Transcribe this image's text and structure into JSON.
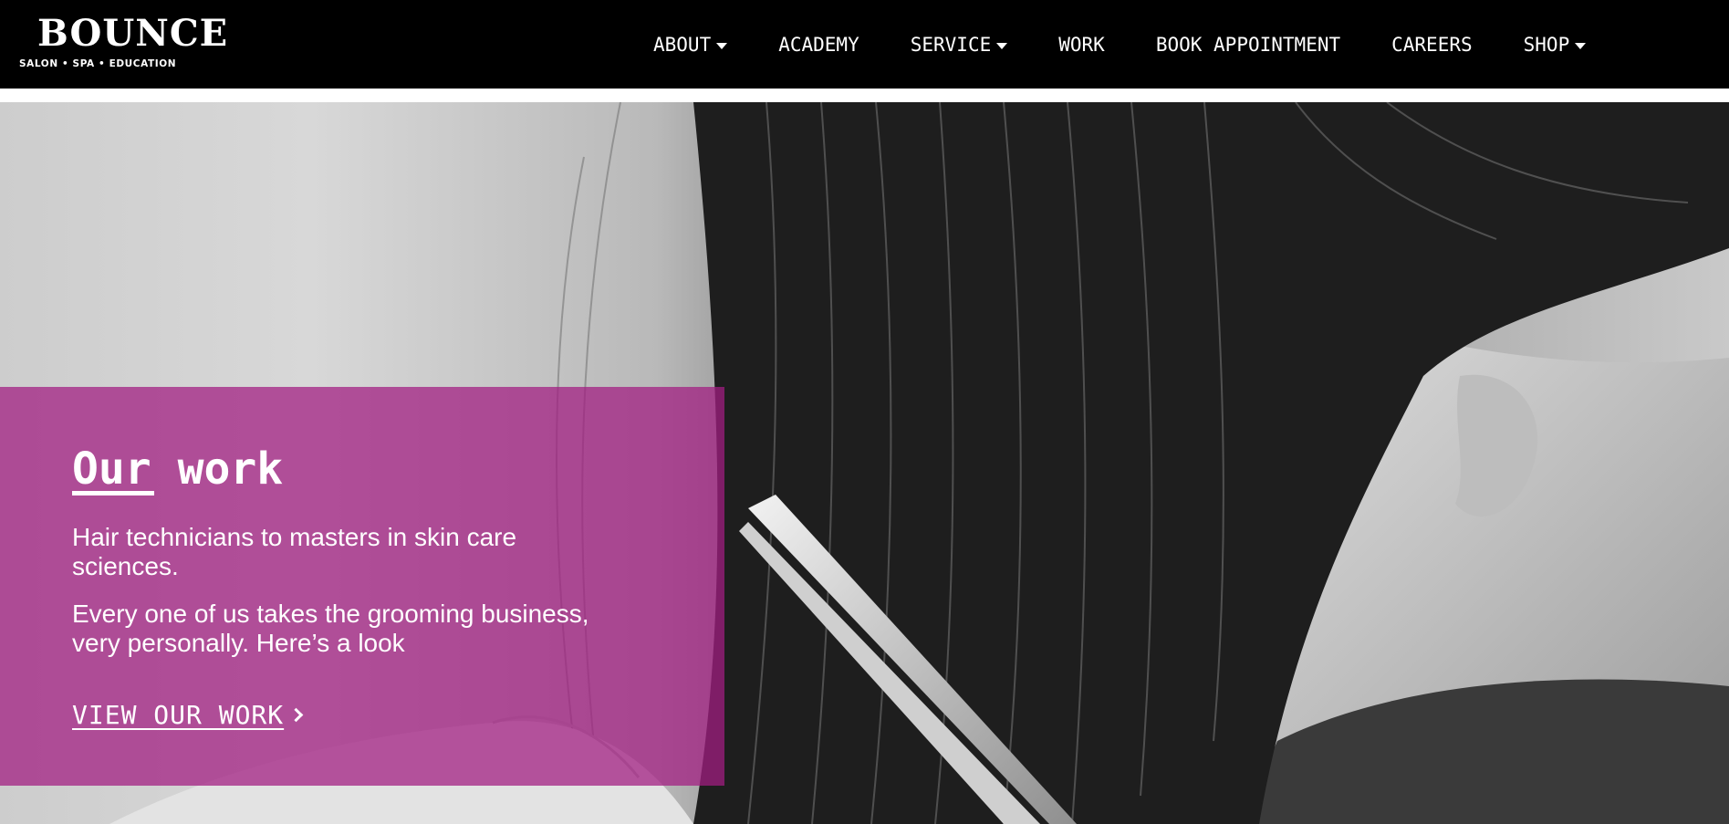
{
  "header": {
    "logo": {
      "name": "BOUNCE",
      "tagline": "SALON • SPA • EDUCATION"
    },
    "nav": [
      {
        "label": "ABOUT",
        "has_dropdown": true
      },
      {
        "label": "ACADEMY",
        "has_dropdown": false
      },
      {
        "label": "SERVICE",
        "has_dropdown": true
      },
      {
        "label": "WORK",
        "has_dropdown": false
      },
      {
        "label": "BOOK APPOINTMENT",
        "has_dropdown": false
      },
      {
        "label": "CAREERS",
        "has_dropdown": false
      },
      {
        "label": "SHOP",
        "has_dropdown": true
      }
    ]
  },
  "hero": {
    "image_icon": "hair-cutting-photo",
    "promo": {
      "title": "Our work",
      "paragraphs": [
        "Hair technicians to masters in skin care sciences.",
        "Every one of us takes the grooming business, very personally. Here’s a look"
      ],
      "link_label": "VIEW OUR WORK",
      "link_icon": "chevron-right-icon"
    }
  },
  "colors": {
    "header_bg": "#000000",
    "accent_magenta": "#a21e82",
    "text_light": "#ffffff"
  }
}
